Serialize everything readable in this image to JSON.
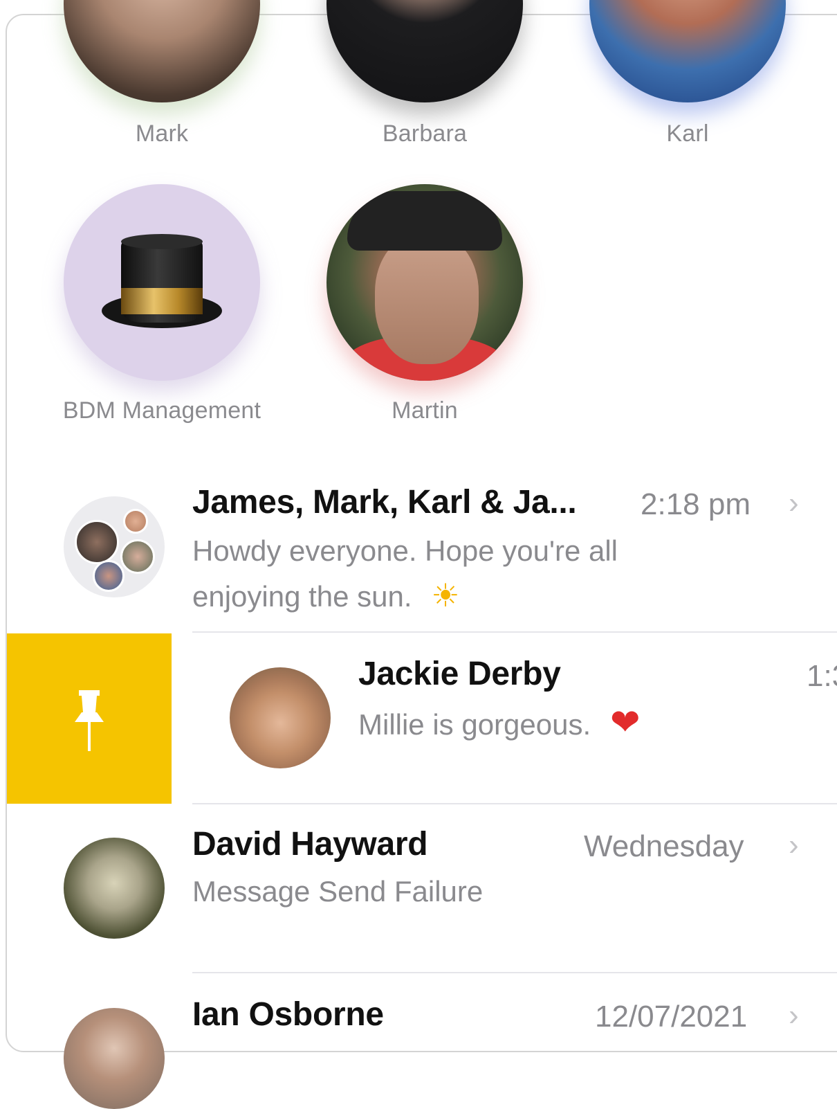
{
  "pinned": [
    {
      "name": "Mark",
      "icon": "person-avatar"
    },
    {
      "name": "Barbara",
      "icon": "person-avatar"
    },
    {
      "name": "Karl",
      "icon": "person-avatar"
    },
    {
      "name": "BDM Management",
      "icon": "top-hat-emoji"
    },
    {
      "name": "Martin",
      "icon": "person-avatar"
    }
  ],
  "conversations": [
    {
      "title": "James, Mark, Karl & Ja...",
      "time": "2:18 pm",
      "preview_line1": "Howdy everyone. Hope you're all",
      "preview_line2": "enjoying the sun.",
      "emoji": "☀",
      "emoji_name": "sun-emoji"
    },
    {
      "title": "Jackie  Derby",
      "time": "1:3",
      "preview": "Millie is gorgeous.",
      "emoji": "❤",
      "emoji_name": "red-heart-emoji",
      "swiped": true
    },
    {
      "title": "David Hayward",
      "time": "Wednesday",
      "preview": "Message Send Failure"
    },
    {
      "title": "Ian Osborne",
      "time": "12/07/2021"
    }
  ],
  "chevron": "›",
  "pin_action_color": "#f5c400"
}
